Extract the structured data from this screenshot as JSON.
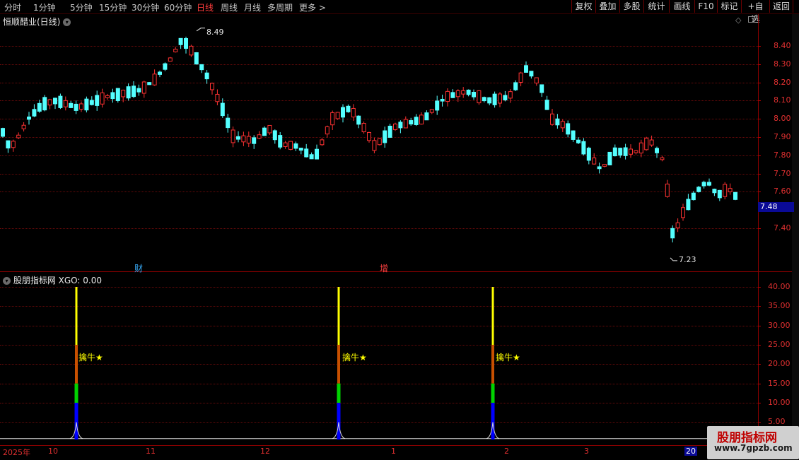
{
  "toolbar": {
    "periods": [
      "分时",
      "1分钟",
      "5分钟",
      "15分钟",
      "30分钟",
      "60分钟",
      "日线",
      "周线",
      "月线",
      "多周期",
      "更多 >"
    ],
    "active_period": "日线",
    "buttons": [
      "复权",
      "叠加",
      "多股",
      "统计",
      "画线",
      "F10",
      "标记",
      "+自选",
      "返回"
    ]
  },
  "price_panel": {
    "title": "恒顺醋业(日线)",
    "high_label": "8.49",
    "low_label": "7.23",
    "current_price": "7.48",
    "y_ticks": [
      "8.40",
      "8.30",
      "8.20",
      "8.10",
      "8.00",
      "7.90",
      "7.80",
      "7.70",
      "7.60",
      "7.40"
    ],
    "events": [
      {
        "text": "财",
        "color": "#3ab0ff"
      },
      {
        "text": "增",
        "color": "#ff4040"
      }
    ]
  },
  "indicator_panel": {
    "title": "股朋指标网 XGO: 0.00",
    "y_ticks": [
      "40.00",
      "35.00",
      "30.00",
      "25.00",
      "20.00",
      "15.00",
      "10.00",
      "5.00"
    ],
    "signal_label": "擒牛★",
    "signal_count": 3
  },
  "x_axis": {
    "labels": [
      "2025年",
      "10",
      "11",
      "12",
      "1",
      "2",
      "3",
      "20"
    ]
  },
  "watermark": {
    "line1": "股朋指标网",
    "line2": "www.7gpzb.com"
  },
  "colors": {
    "up": "#ff3232",
    "down": "#54ffff",
    "grid": "#8a0000",
    "signal_yellow": "#ffff00",
    "signal_orange": "#c85000",
    "signal_green": "#00d200",
    "signal_blue": "#0000ff"
  }
}
